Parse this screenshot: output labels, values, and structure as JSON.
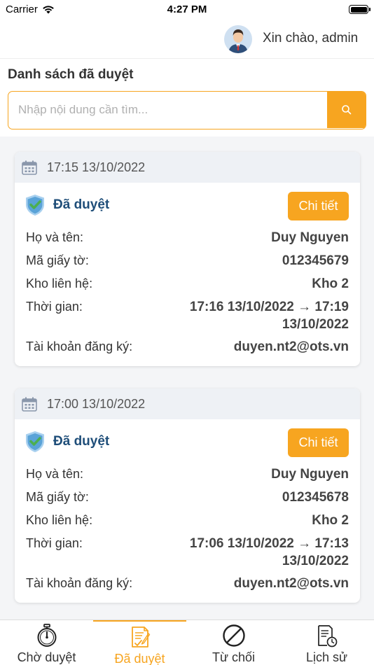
{
  "status_bar": {
    "carrier": "Carrier",
    "time": "4:27 PM"
  },
  "header": {
    "greeting": "Xin chào, admin"
  },
  "page_title": "Danh sách đã duyệt",
  "search": {
    "placeholder": "Nhập nội dung cần tìm...",
    "value": ""
  },
  "colors": {
    "accent": "#f7a520",
    "status_text": "#1f4e79",
    "card_header_bg": "#eef1f5"
  },
  "labels": {
    "full_name": "Họ và tên:",
    "doc_id": "Mã giấy tờ:",
    "warehouse": "Kho liên hệ:",
    "time": "Thời gian:",
    "account": "Tài khoản đăng ký:"
  },
  "cards": [
    {
      "date": "17:15 13/10/2022",
      "status": "Đã duyệt",
      "detail_label": "Chi tiết",
      "full_name": "Duy Nguyen",
      "doc_id": "012345679",
      "warehouse": "Kho 2",
      "time_line1": "17:16 13/10/2022 → 17:19",
      "time_line2": "13/10/2022",
      "account": "duyen.nt2@ots.vn"
    },
    {
      "date": "17:00 13/10/2022",
      "status": "Đã duyệt",
      "detail_label": "Chi tiết",
      "full_name": "Duy Nguyen",
      "doc_id": "012345678",
      "warehouse": "Kho 2",
      "time_line1": "17:06 13/10/2022 → 17:13",
      "time_line2": "13/10/2022",
      "account": "duyen.nt2@ots.vn"
    }
  ],
  "tabs": [
    {
      "label": "Chờ duyệt",
      "icon": "stopwatch-icon",
      "active": false
    },
    {
      "label": "Đã duyệt",
      "icon": "approved-document-icon",
      "active": true
    },
    {
      "label": "Từ chối",
      "icon": "prohibited-icon",
      "active": false
    },
    {
      "label": "Lịch sử",
      "icon": "history-document-icon",
      "active": false
    }
  ]
}
